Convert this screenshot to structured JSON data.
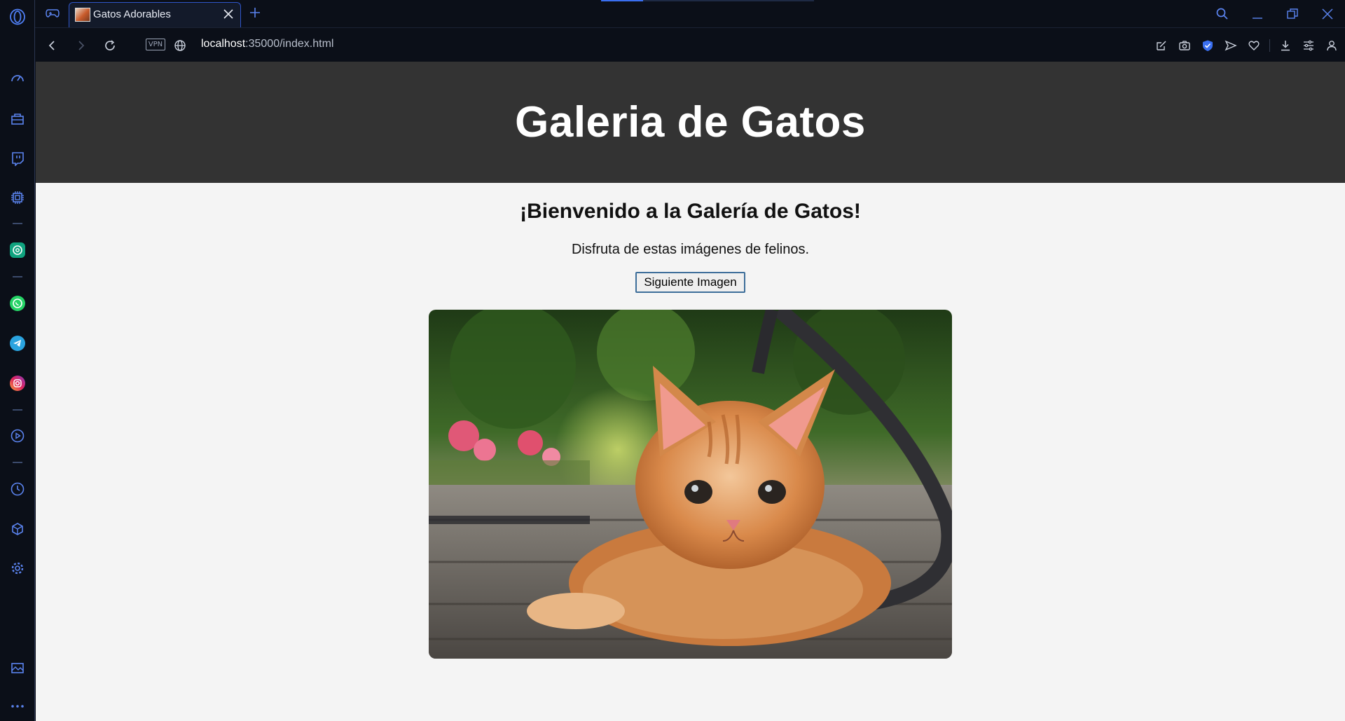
{
  "browser": {
    "tab_title": "Gatos Adorables",
    "url_host": "localhost",
    "url_rest": ":35000/index.html",
    "vpn_label": "VPN"
  },
  "page": {
    "header_title": "Galeria de Gatos",
    "welcome": "¡Bienvenido a la Galería de Gatos!",
    "subtitle": "Disfruta de estas imágenes de felinos.",
    "button_label": "Siguiente Imagen"
  },
  "colors": {
    "accent": "#2f56c9",
    "page_header_bg": "#333333",
    "page_bg": "#f4f4f4"
  }
}
